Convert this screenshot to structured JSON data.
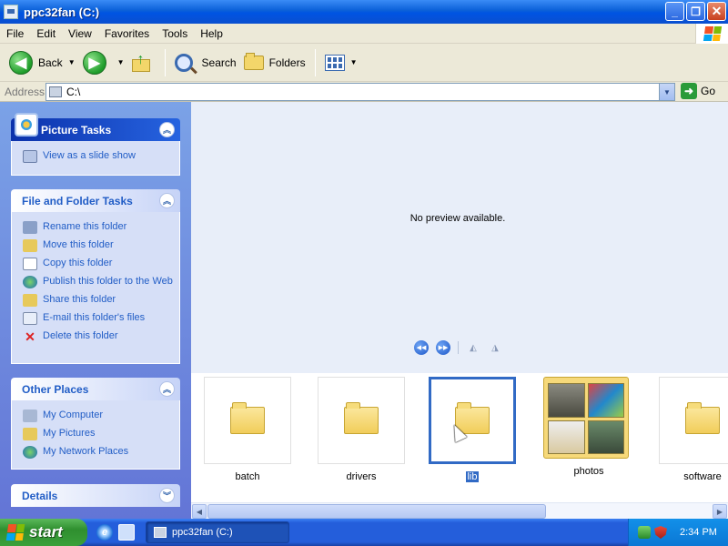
{
  "window": {
    "title": "ppc32fan (C:)",
    "buttons": {
      "minimize": "_",
      "maximize": "❐",
      "close": "✕"
    }
  },
  "menu": [
    "File",
    "Edit",
    "View",
    "Favorites",
    "Tools",
    "Help"
  ],
  "toolbar": {
    "back": "Back",
    "forward_caret": "▾",
    "search": "Search",
    "folders": "Folders"
  },
  "address": {
    "label": "Address",
    "value": "C:\\",
    "go": "Go"
  },
  "taskpane": {
    "picture_tasks": {
      "title": "Picture Tasks",
      "items": [
        "View as a slide show"
      ]
    },
    "file_folder_tasks": {
      "title": "File and Folder Tasks",
      "items": [
        "Rename this folder",
        "Move this folder",
        "Copy this folder",
        "Publish this folder to the Web",
        "Share this folder",
        "E-mail this folder's files",
        "Delete this folder"
      ]
    },
    "other_places": {
      "title": "Other Places",
      "items": [
        "My Computer",
        "My Pictures",
        "My Network Places"
      ]
    },
    "details": {
      "title": "Details"
    }
  },
  "preview": {
    "message": "No preview available."
  },
  "filmstrip": {
    "items": [
      {
        "label": "batch",
        "type": "folder"
      },
      {
        "label": "drivers",
        "type": "folder"
      },
      {
        "label": "lib",
        "type": "folder",
        "selected": true
      },
      {
        "label": "photos",
        "type": "photos"
      },
      {
        "label": "software",
        "type": "folder"
      }
    ]
  },
  "taskbar": {
    "start": "start",
    "task_item": "ppc32fan (C:)",
    "clock": "2:34 PM"
  },
  "icons": {
    "back": "back-arrow-icon",
    "forward": "forward-arrow-icon",
    "up": "folder-up-icon",
    "search": "search-icon",
    "folders": "folders-icon",
    "views": "views-icon"
  }
}
